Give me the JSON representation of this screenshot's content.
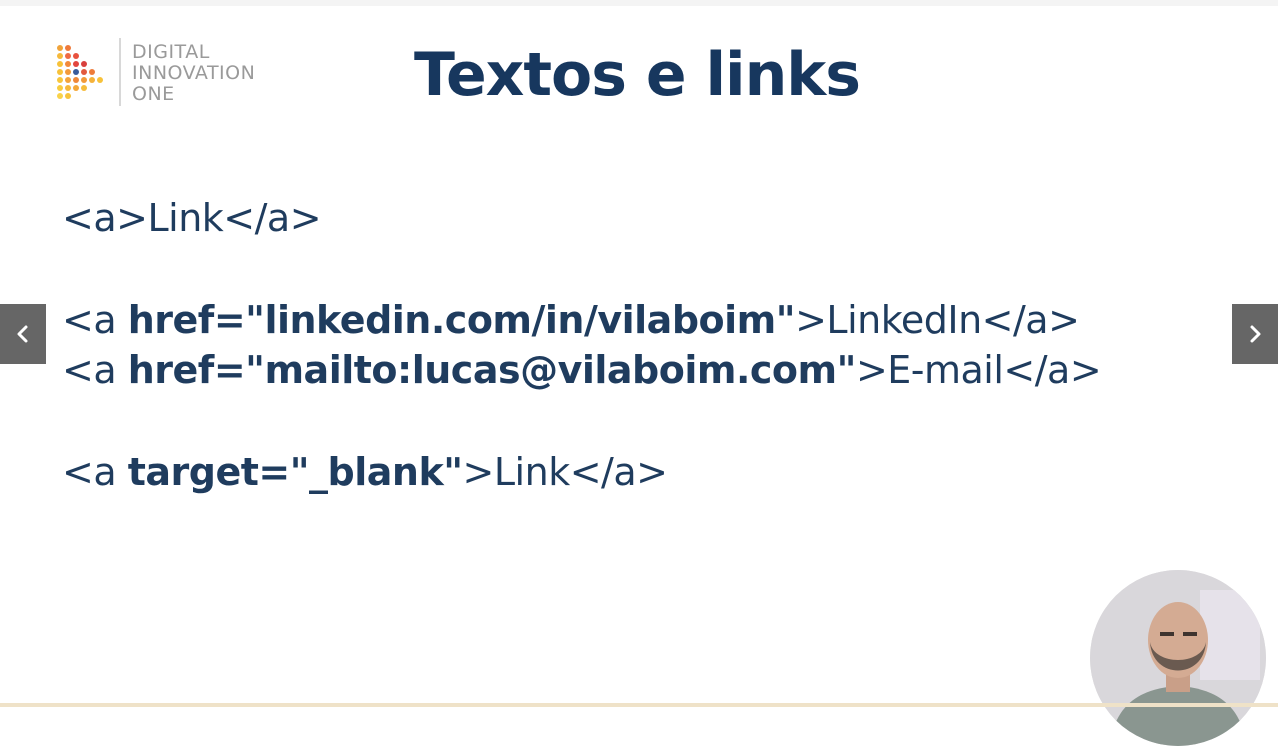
{
  "brand": {
    "line1": "DIGITAL",
    "line2": "INNOVATION",
    "line3": "ONE"
  },
  "slide": {
    "title": "Textos e links",
    "lines": [
      {
        "pre": "<a>Link</a>",
        "bold": "",
        "post": ""
      },
      {
        "pre": "<a ",
        "bold": "href=\"linkedin.com/in/vilaboim\"",
        "post": ">LinkedIn</a>"
      },
      {
        "pre": "<a ",
        "bold": "href=\"mailto:lucas@vilaboim.com\"",
        "post": ">E-mail</a>"
      },
      {
        "pre": "<a ",
        "bold": "target=\"_blank\"",
        "post": ">Link</a>"
      }
    ]
  },
  "navigation": {
    "prev_icon": "chevron-left-icon",
    "next_icon": "chevron-right-icon"
  },
  "colors": {
    "title": "#17375e",
    "code": "#1f3c5e",
    "nav_button": "#666666",
    "brand_text": "#9a9a9a"
  }
}
